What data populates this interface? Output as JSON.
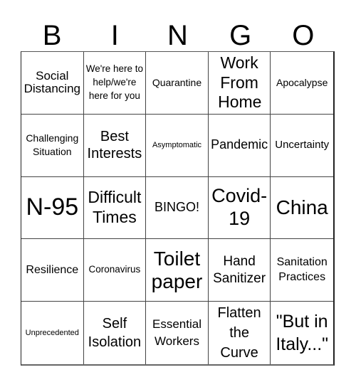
{
  "header": {
    "letters": [
      "B",
      "I",
      "N",
      "G",
      "O"
    ]
  },
  "board": {
    "rows": [
      [
        "Social Distancing",
        "We're here to help/we're here for you",
        "Quarantine",
        "Work From Home",
        "Apocalypse"
      ],
      [
        "Challenging Situation",
        "Best Interests",
        "Asymptomatic",
        "Pandemic",
        "Uncertainty"
      ],
      [
        "N-95",
        "Difficult Times",
        "BINGO!",
        "Covid-19",
        "China"
      ],
      [
        "Resilience",
        "Coronavirus",
        "Toilet paper",
        "Hand Sanitizer",
        "Sanitation Practices"
      ],
      [
        "Unprecedented",
        "Self Isolation",
        "Essential Workers",
        "Flatten the Curve",
        "\"But in Italy...\""
      ]
    ],
    "free_space": "BINGO!"
  },
  "colors": {
    "grid_line": "#444444",
    "text": "#000000",
    "background": "#ffffff"
  }
}
